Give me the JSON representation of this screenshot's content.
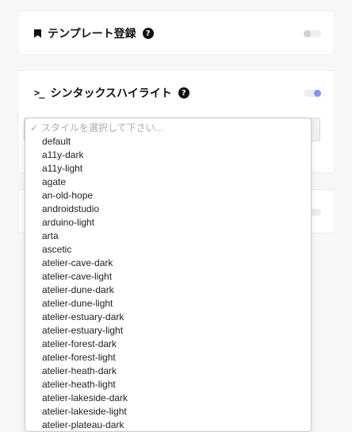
{
  "template_card": {
    "title": "テンプレート登録",
    "help": "?",
    "icon": "bookmark-icon",
    "toggle_on": false
  },
  "syntax_card": {
    "title": "シンタックスハイライト",
    "help": "?",
    "icon": "terminal-icon",
    "toggle_on": true
  },
  "colors": {
    "accent": "#7f95f3"
  },
  "style_select": {
    "placeholder_check": "✓",
    "placeholder": "スタイルを選択して下さい...",
    "options": [
      "default",
      "a11y-dark",
      "a11y-light",
      "agate",
      "an-old-hope",
      "androidstudio",
      "arduino-light",
      "arta",
      "ascetic",
      "atelier-cave-dark",
      "atelier-cave-light",
      "atelier-dune-dark",
      "atelier-dune-light",
      "atelier-estuary-dark",
      "atelier-estuary-light",
      "atelier-forest-dark",
      "atelier-forest-light",
      "atelier-heath-dark",
      "atelier-heath-light",
      "atelier-lakeside-dark",
      "atelier-lakeside-light",
      "atelier-plateau-dark"
    ]
  }
}
